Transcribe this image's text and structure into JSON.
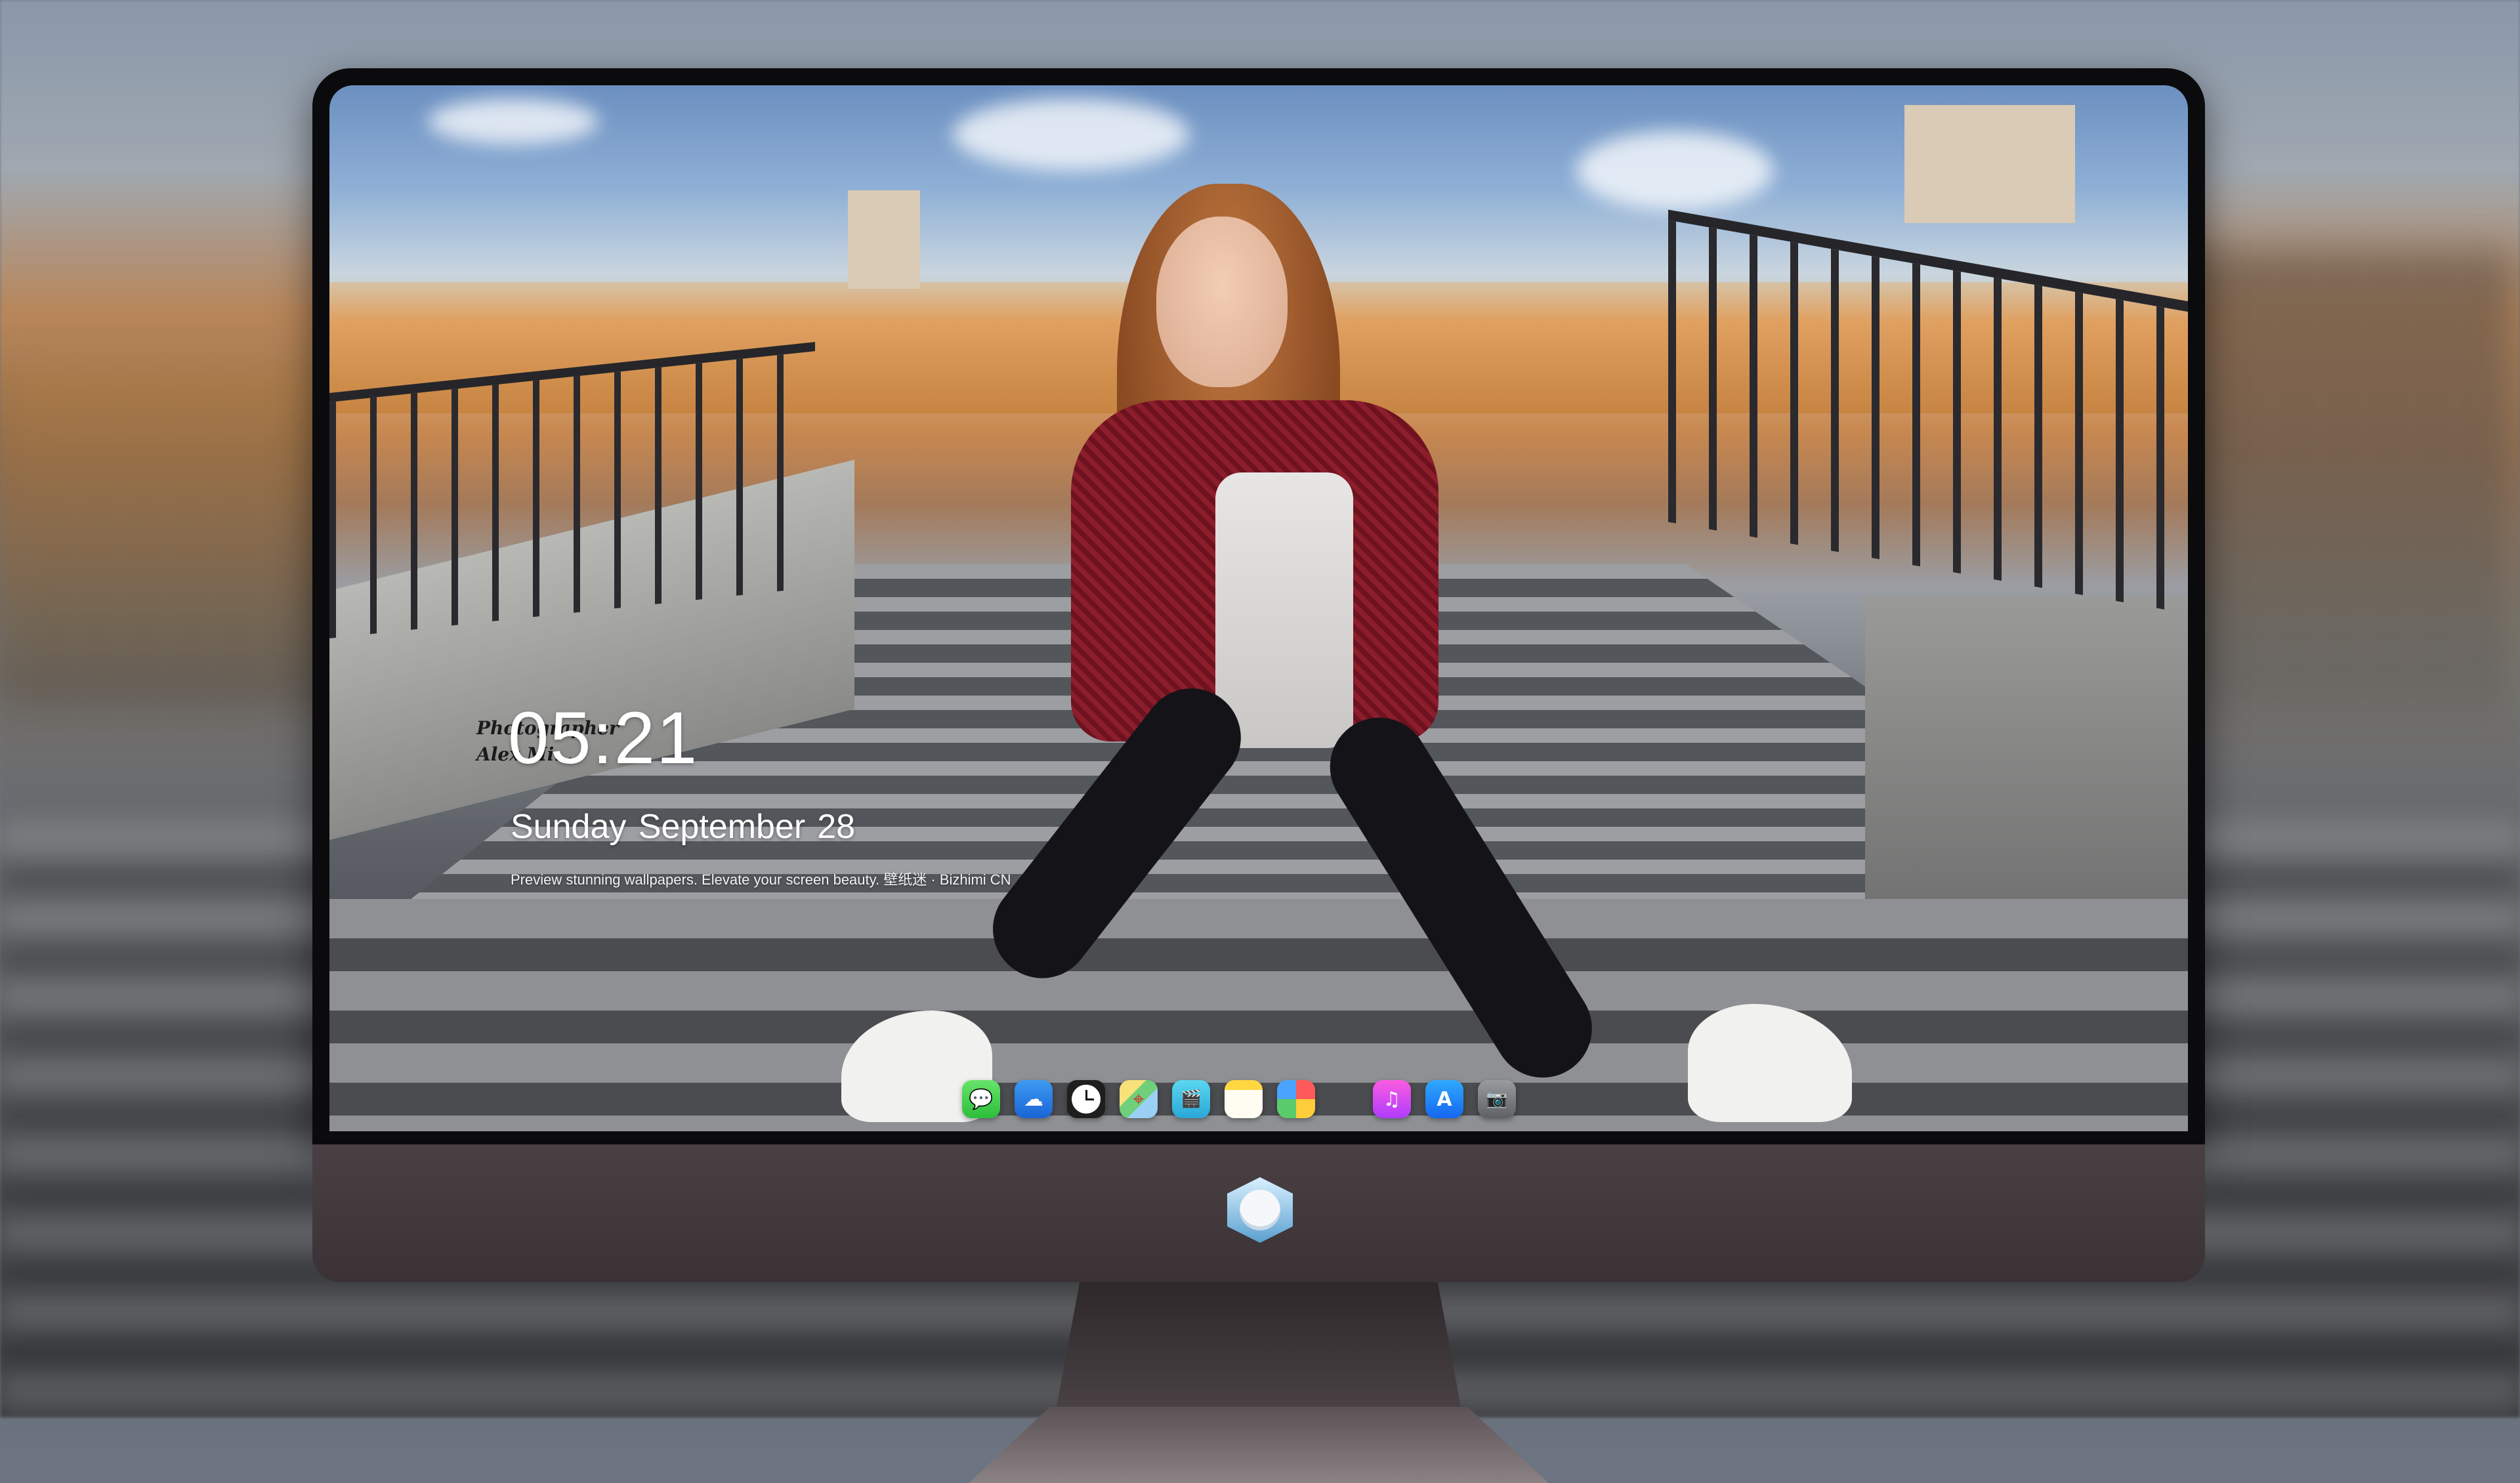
{
  "lockscreen": {
    "photographer_credit_line1": "Photographer",
    "photographer_credit_line2": "Alex Mi...",
    "time": "05:21",
    "date_weekday_month": "Sunday September",
    "date_day": "28",
    "tagline": "Preview stunning wallpapers. Elevate your screen beauty. 壁纸迷 · Bizhimi CN"
  },
  "dock": {
    "apps": [
      {
        "name": "Messages",
        "icon": "messages-icon",
        "glyph": "💬"
      },
      {
        "name": "Weather",
        "icon": "weather-icon",
        "glyph": "☁"
      },
      {
        "name": "Clock",
        "icon": "clock-icon",
        "glyph": ""
      },
      {
        "name": "Maps",
        "icon": "maps-icon",
        "glyph": "⌖"
      },
      {
        "name": "Clips",
        "icon": "clips-icon",
        "glyph": "🎬"
      },
      {
        "name": "Notes",
        "icon": "notes-icon",
        "glyph": ""
      },
      {
        "name": "Photos",
        "icon": "photos-icon",
        "glyph": ""
      },
      {
        "name": "Music",
        "icon": "music-icon",
        "glyph": "♫"
      },
      {
        "name": "App Store",
        "icon": "app-store-icon",
        "glyph": "A"
      },
      {
        "name": "Camera",
        "icon": "camera-icon",
        "glyph": "📷"
      }
    ]
  },
  "monitor": {
    "logo": "bizhimi-hexagon-logo"
  },
  "colors": {
    "bezel": "#0b0b0d",
    "chin": "#3a3235",
    "clock_text": "#ffffff"
  }
}
